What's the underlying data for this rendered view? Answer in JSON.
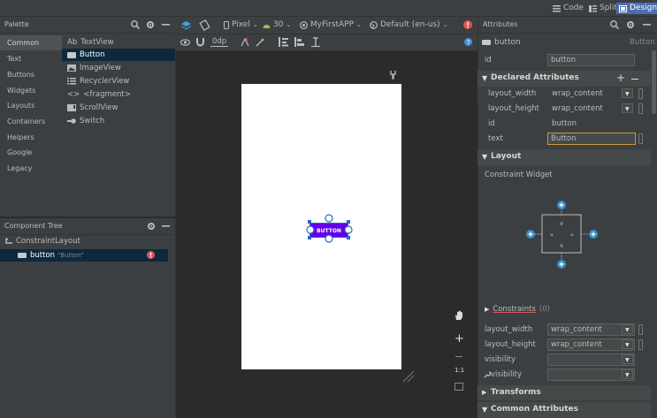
{
  "topbar": {
    "code_label": "Code",
    "split_label": "Split",
    "design_label": "Design"
  },
  "palette": {
    "title": "Palette",
    "categories": [
      "Common",
      "Text",
      "Buttons",
      "Widgets",
      "Layouts",
      "Containers",
      "Helpers",
      "Google",
      "Legacy"
    ],
    "widgets": [
      {
        "label": "TextView",
        "icon": "textview-icon",
        "prefix": "Ab"
      },
      {
        "label": "Button",
        "icon": "button-icon",
        "prefix": ""
      },
      {
        "label": "ImageView",
        "icon": "imageview-icon",
        "prefix": ""
      },
      {
        "label": "RecyclerView",
        "icon": "recyclerview-icon",
        "prefix": ""
      },
      {
        "label": "<fragment>",
        "icon": "fragment-icon",
        "prefix": "<>"
      },
      {
        "label": "ScrollView",
        "icon": "scrollview-icon",
        "prefix": ""
      },
      {
        "label": "Switch",
        "icon": "switch-icon",
        "prefix": ""
      }
    ]
  },
  "component_tree": {
    "title": "Component Tree",
    "root": "ConstraintLayout",
    "child_label": "button",
    "child_text": "\"Button\""
  },
  "design_toolbar": {
    "device": "Pixel",
    "api": "30",
    "app": "MyFirstAPP",
    "locale": "Default (en-us)",
    "margin": "0dp"
  },
  "design": {
    "button_text": "BUTTON"
  },
  "zoom": {
    "fit_label": "1:1"
  },
  "attributes": {
    "title": "Attributes",
    "component": "button",
    "component_type": "Button",
    "id_label": "id",
    "id_value": "button",
    "declared_title": "Declared Attributes",
    "declared": [
      {
        "name": "layout_width",
        "value": "wrap_content"
      },
      {
        "name": "layout_height",
        "value": "wrap_content"
      },
      {
        "name": "id",
        "value": "button"
      },
      {
        "name": "text",
        "value": "Button"
      }
    ],
    "layout_title": "Layout",
    "constraint_widget": "Constraint Widget",
    "constraints_label": "Constraints",
    "constraints_count": "(0)",
    "layout_rows": [
      {
        "name": "layout_width",
        "value": "wrap_content"
      },
      {
        "name": "layout_height",
        "value": "wrap_content"
      },
      {
        "name": "visibility",
        "value": ""
      },
      {
        "name": "visibility",
        "value": ""
      }
    ],
    "transforms_title": "Transforms",
    "common_title": "Common Attributes"
  },
  "colors": {
    "accent": "#4b6eaf",
    "button": "#6200ee",
    "error": "#e05555"
  }
}
